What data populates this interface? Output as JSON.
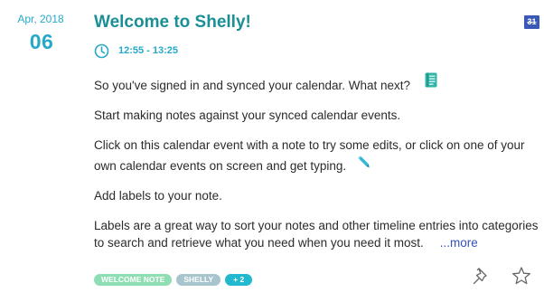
{
  "event": {
    "month": "Apr, 2018",
    "day": "06",
    "title": "Welcome to Shelly!",
    "time": "12:55 - 13:25",
    "calendar_day": "31"
  },
  "note": {
    "line1": "So you've signed in and synced your calendar. What next?",
    "line2": "Start making notes against your synced calendar events.",
    "line3a": "Click on this calendar event with a note to try some edits, or click on one of your",
    "line3b": "own calendar events on screen and get typing.",
    "line4": "Add labels to your note.",
    "line5a": "Labels are a great way to sort your notes and other timeline entries into categories",
    "line5b": "to search and retrieve what you need when you need it most.",
    "more_label": "...more"
  },
  "tags": [
    "WELCOME NOTE",
    "SHELLY",
    "+ 2"
  ],
  "colors": {
    "accent": "#26a9c9",
    "title": "#1a8f95",
    "link": "#3550c0",
    "tag_welcome": "#8fddb2",
    "tag_shelly": "#a8c4cd",
    "tag_more": "#22b8cd",
    "calendar_icon": "#3a58b5"
  },
  "icons": [
    "clock-icon",
    "calendar-icon",
    "notebook-icon",
    "pencil-icon",
    "pin-icon",
    "star-icon"
  ]
}
